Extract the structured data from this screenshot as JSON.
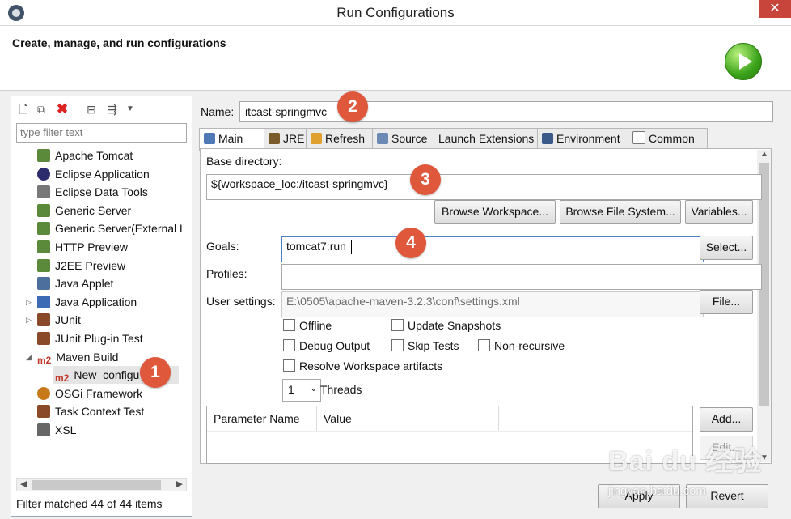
{
  "window": {
    "title": "Run Configurations",
    "close_glyph": "✕"
  },
  "header": {
    "title": "Create, manage, and run configurations"
  },
  "left": {
    "filter_placeholder": "type filter text",
    "items": [
      {
        "label": "Apache Tomcat",
        "icon": "server-icon",
        "color": "#5a8a3a"
      },
      {
        "label": "Eclipse Application",
        "icon": "eclipse-icon",
        "color": "#2c2c6c"
      },
      {
        "label": "Eclipse Data Tools",
        "icon": "database-icon",
        "color": "#777777"
      },
      {
        "label": "Generic Server",
        "icon": "server-icon",
        "color": "#5a8a3a"
      },
      {
        "label": "Generic Server(External L",
        "icon": "server-icon",
        "color": "#5a8a3a"
      },
      {
        "label": "HTTP Preview",
        "icon": "server-icon",
        "color": "#5a8a3a"
      },
      {
        "label": "J2EE Preview",
        "icon": "server-icon",
        "color": "#5a8a3a"
      },
      {
        "label": "Java Applet",
        "icon": "applet-icon",
        "color": "#4d6f9e"
      },
      {
        "label": "Java Application",
        "icon": "java-app-icon",
        "color": "#3c6ab5"
      },
      {
        "label": "JUnit",
        "icon": "junit-icon",
        "color": "#8a4a2a"
      },
      {
        "label": "JUnit Plug-in Test",
        "icon": "junit-plugin-icon",
        "color": "#8a4a2a"
      },
      {
        "label": "Maven Build",
        "icon": "maven-icon",
        "color": "#c0392b"
      },
      {
        "label": "New_configu",
        "icon": "maven-icon",
        "color": "#c0392b"
      },
      {
        "label": "OSGi Framework",
        "icon": "osgi-icon",
        "color": "#c87a1a"
      },
      {
        "label": "Task Context Test",
        "icon": "task-icon",
        "color": "#8a4a2a"
      },
      {
        "label": "XSL",
        "icon": "xsl-icon",
        "color": "#666666"
      }
    ],
    "m2": "m2",
    "status": "Filter matched 44 of 44 items"
  },
  "right": {
    "name_label": "Name:",
    "name_value": "itcast-springmvc",
    "tabs": [
      {
        "label": "Main",
        "icon": "main-tab-icon"
      },
      {
        "label": "JRE",
        "icon": "jre-icon"
      },
      {
        "label": "Refresh",
        "icon": "refresh-icon"
      },
      {
        "label": "Source",
        "icon": "source-icon"
      },
      {
        "label": "Launch Extensions",
        "icon": ""
      },
      {
        "label": "Environment",
        "icon": "environment-icon"
      },
      {
        "label": "Common",
        "icon": "common-icon"
      }
    ],
    "base_dir_label": "Base directory:",
    "base_dir_value": "${workspace_loc:/itcast-springmvc}",
    "browse_workspace": "Browse Workspace...",
    "browse_fs": "Browse File System...",
    "variables": "Variables...",
    "goals_label": "Goals:",
    "goals_value": "tomcat7:run",
    "select": "Select...",
    "profiles_label": "Profiles:",
    "profiles_value": "",
    "user_settings_label": "User settings:",
    "user_settings_value": "E:\\0505\\apache-maven-3.2.3\\conf\\settings.xml",
    "file": "File...",
    "checkboxes": {
      "offline": "Offline",
      "update_snapshots": "Update Snapshots",
      "debug_output": "Debug Output",
      "skip_tests": "Skip Tests",
      "non_recursive": "Non-recursive",
      "resolve_workspace": "Resolve Workspace artifacts"
    },
    "threads_value": "1",
    "threads_label": "Threads",
    "table_headers": [
      "Parameter Name",
      "Value"
    ],
    "add": "Add...",
    "edit": "Edit..."
  },
  "footer": {
    "apply": "Apply",
    "revert": "Revert"
  },
  "badges": [
    "1",
    "2",
    "3",
    "4"
  ],
  "watermark": {
    "text": "Bai du 经验",
    "url": "jingyan.baidu.com"
  }
}
